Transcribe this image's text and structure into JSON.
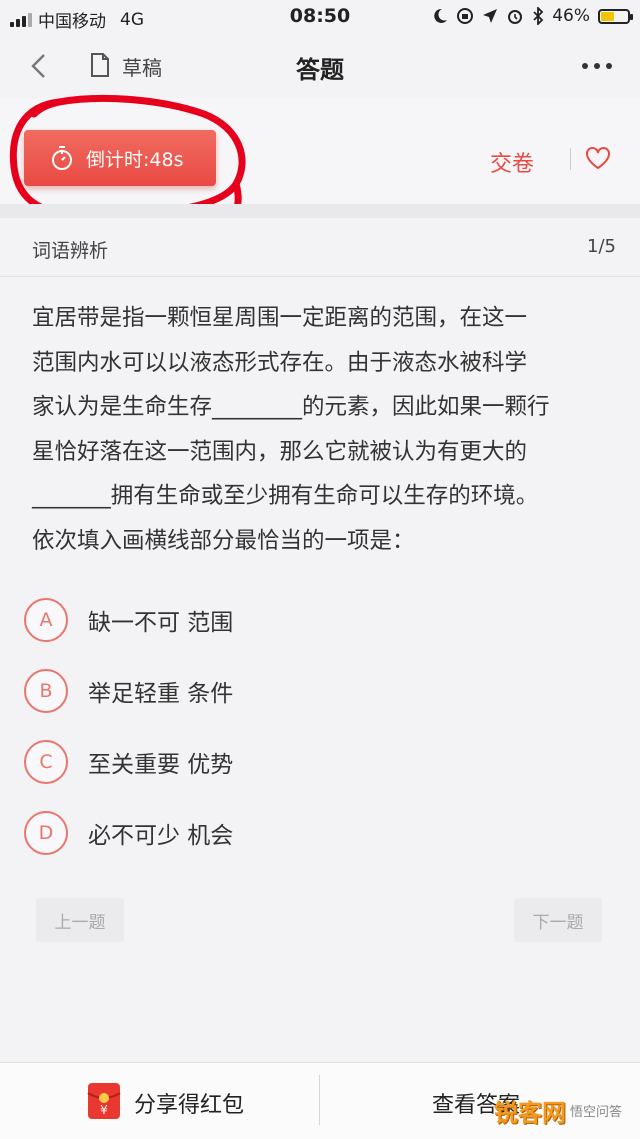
{
  "status_bar": {
    "carrier": "中国移动",
    "network": "4G",
    "time": "08:50",
    "battery": "46%",
    "battery_level": 0.46
  },
  "nav": {
    "draft_label": "草稿",
    "title": "答题"
  },
  "timer": {
    "label": "倒计时:48s"
  },
  "actions": {
    "submit_label": "交卷"
  },
  "question": {
    "category": "词语辨析",
    "progress": "1/5",
    "lines": [
      "宜居带是指一颗恒星周围一定距离的范围，在这一",
      "范围内水可以以液态形式存在。由于液态水被科学",
      "家认为是生命生存________的元素，因此如果一颗行",
      "星恰好落在这一范围内，那么它就被认为有更大的",
      "_______拥有生命或至少拥有生命可以生存的环境。",
      "依次填入画横线部分最恰当的一项是："
    ]
  },
  "options": [
    {
      "letter": "A",
      "text": "缺一不可 范围"
    },
    {
      "letter": "B",
      "text": "举足轻重 条件"
    },
    {
      "letter": "C",
      "text": "至关重要 优势"
    },
    {
      "letter": "D",
      "text": "必不可少 机会"
    }
  ],
  "pager": {
    "prev_label": "上一题",
    "next_label": "下一题"
  },
  "bottom": {
    "share_label": "分享得红包",
    "answer_label": "查看答案",
    "watermark": "锐客网",
    "watermark_sub": "悟空问答"
  },
  "colors": {
    "accent": "#e84a43",
    "option_ring": "#e8766d",
    "annotation": "#e6001c"
  }
}
